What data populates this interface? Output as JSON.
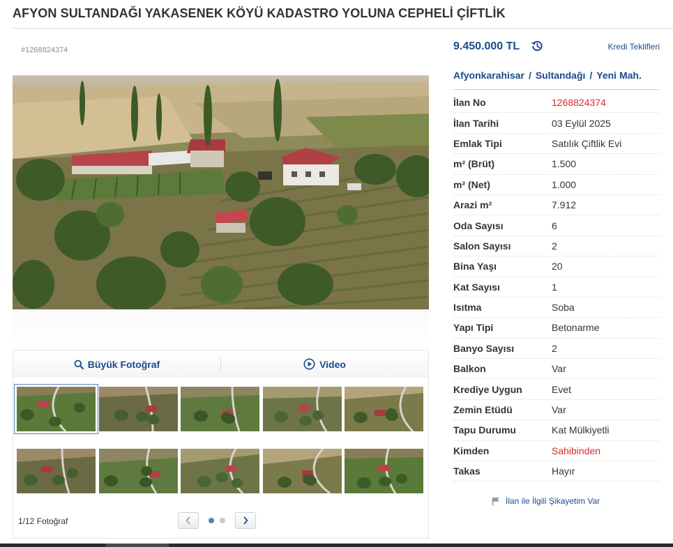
{
  "listing": {
    "title": "AFYON SULTANDAĞI YAKASENEK KÖYÜ KADASTRO YOLUNA CEPHELİ ÇİFTLİK",
    "ad_id": "#1268824374"
  },
  "gallery": {
    "large_photo_label": "Büyük Fotoğraf",
    "video_label": "Video",
    "photo_count": "1/12 Fotoğraf",
    "thumbnail_count": 10,
    "active_thumbnail": 1,
    "active_page_dot": 1,
    "page_dots": 2
  },
  "price": {
    "amount": "9.450.000 TL",
    "credit_link": "Kredi Teklifleri"
  },
  "location": {
    "city": "Afyonkarahisar",
    "district": "Sultandağı",
    "neighborhood": "Yeni Mah.",
    "separator": "/"
  },
  "specs": [
    {
      "label": "İlan No",
      "value": "1268824374",
      "highlight": true
    },
    {
      "label": "İlan Tarihi",
      "value": "03 Eylül 2025"
    },
    {
      "label": "Emlak Tipi",
      "value": "Satılık Çiftlik Evi"
    },
    {
      "label": "m² (Brüt)",
      "value": "1.500"
    },
    {
      "label": "m² (Net)",
      "value": "1.000"
    },
    {
      "label": "Arazi m²",
      "value": "7.912"
    },
    {
      "label": "Oda Sayısı",
      "value": "6"
    },
    {
      "label": "Salon Sayısı",
      "value": "2"
    },
    {
      "label": "Bina Yaşı",
      "value": "20"
    },
    {
      "label": "Kat Sayısı",
      "value": "1"
    },
    {
      "label": "Isıtma",
      "value": "Soba"
    },
    {
      "label": "Yapı Tipi",
      "value": "Betonarme"
    },
    {
      "label": "Banyo Sayısı",
      "value": "2"
    },
    {
      "label": "Balkon",
      "value": "Var"
    },
    {
      "label": "Krediye Uygun",
      "value": "Evet"
    },
    {
      "label": "Zemin Etüdü",
      "value": "Var"
    },
    {
      "label": "Tapu Durumu",
      "value": "Kat Mülkiyetli"
    },
    {
      "label": "Kimden",
      "value": "Sahibinden",
      "highlight": true
    },
    {
      "label": "Takas",
      "value": "Hayır"
    }
  ],
  "complaint": {
    "label": "İlan ile İlgili Şikayetim Var"
  },
  "colors": {
    "link_blue": "#1a4b8f",
    "highlight_red": "#d72c2c",
    "active_dot": "#5a7fb8"
  },
  "icons": {
    "search": "search-icon",
    "video": "play-circle-icon",
    "history": "history-icon",
    "flag": "flag-icon",
    "prev": "chevron-left-icon",
    "next": "chevron-right-icon"
  }
}
